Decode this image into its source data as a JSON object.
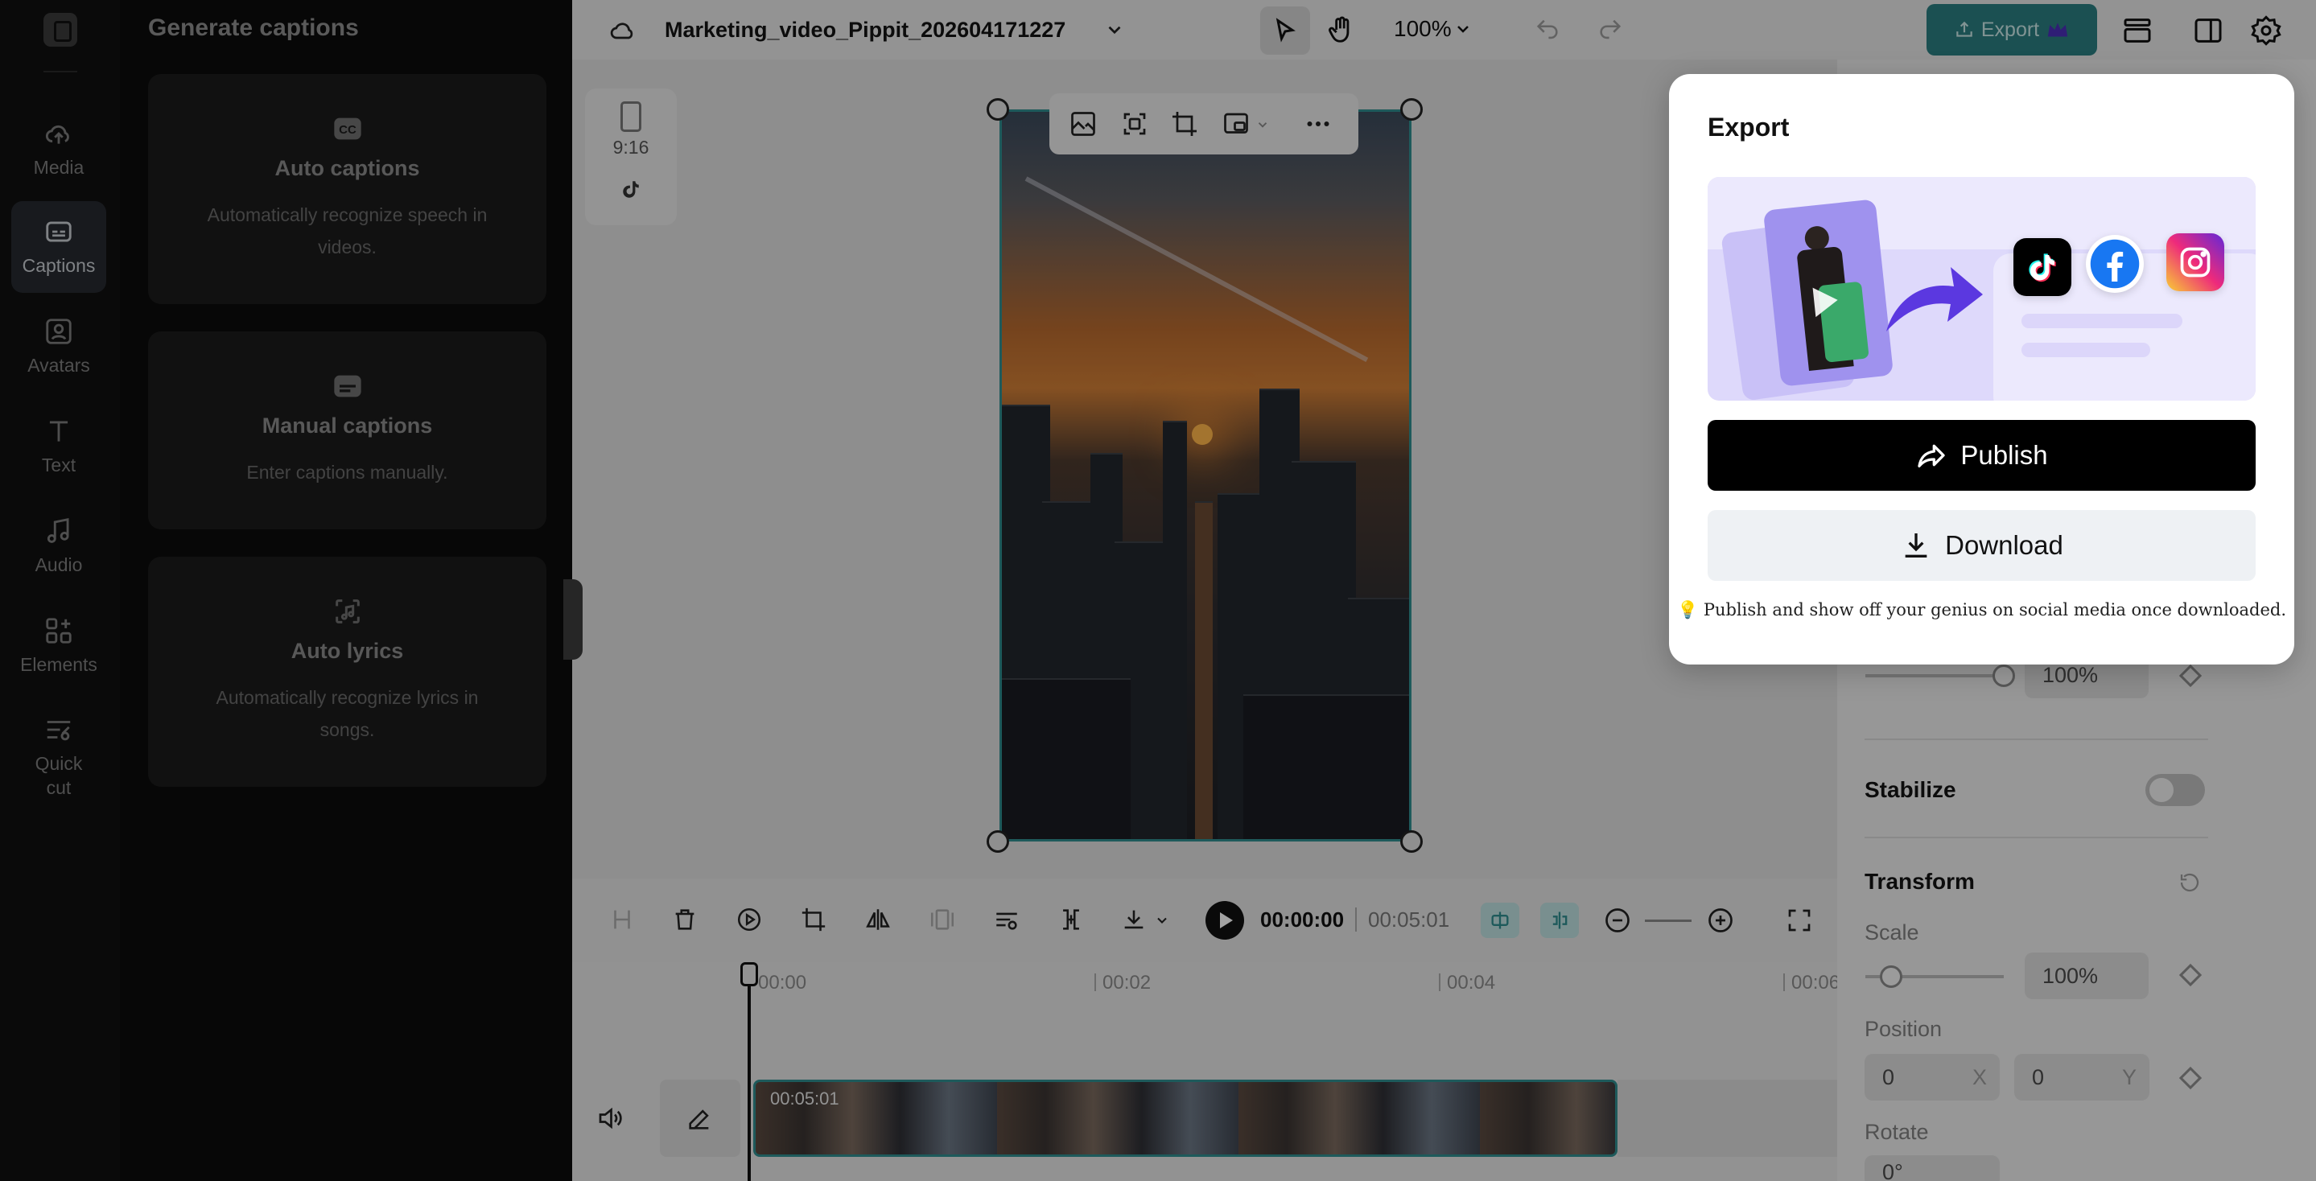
{
  "project": {
    "title": "Marketing_video_Pippit_202604171227",
    "zoom": "100%",
    "export_label": "Export"
  },
  "nav": {
    "items": [
      {
        "label": "Media"
      },
      {
        "label": "Captions"
      },
      {
        "label": "Avatars"
      },
      {
        "label": "Text"
      },
      {
        "label": "Audio"
      },
      {
        "label": "Elements"
      },
      {
        "label": "Quick\ncut"
      }
    ]
  },
  "captions_panel": {
    "title": "Generate captions",
    "cards": [
      {
        "title": "Auto captions",
        "desc": "Automatically recognize speech in videos."
      },
      {
        "title": "Manual captions",
        "desc": "Enter captions manually."
      },
      {
        "title": "Auto lyrics",
        "desc": "Automatically recognize lyrics in songs."
      }
    ]
  },
  "canvas": {
    "ratio": "9:16"
  },
  "playback": {
    "current_time": "00:00:00",
    "total_time": "00:05:01"
  },
  "timeline": {
    "ticks": [
      "00:00",
      "00:02",
      "00:04",
      "00:06"
    ],
    "clip_duration": "00:05:01"
  },
  "properties": {
    "opacity_value": "100%",
    "stabilize_label": "Stabilize",
    "transform_label": "Transform",
    "scale_label": "Scale",
    "scale_value": "100%",
    "position_label": "Position",
    "position_x": "0",
    "position_y": "0",
    "x_label": "X",
    "y_label": "Y",
    "rotate_label": "Rotate",
    "rotate_value": "0°"
  },
  "export_dialog": {
    "title": "Export",
    "publish_label": "Publish",
    "download_label": "Download",
    "hint": "💡 Publish and show off your genius on social media once downloaded.",
    "platforms": [
      "tiktok-icon",
      "facebook-icon",
      "instagram-icon"
    ]
  },
  "colors": {
    "accent": "#2f8d8f",
    "publish_bg": "#000000",
    "download_bg": "#eef1f4",
    "hero_bg": "#ded9fb"
  }
}
